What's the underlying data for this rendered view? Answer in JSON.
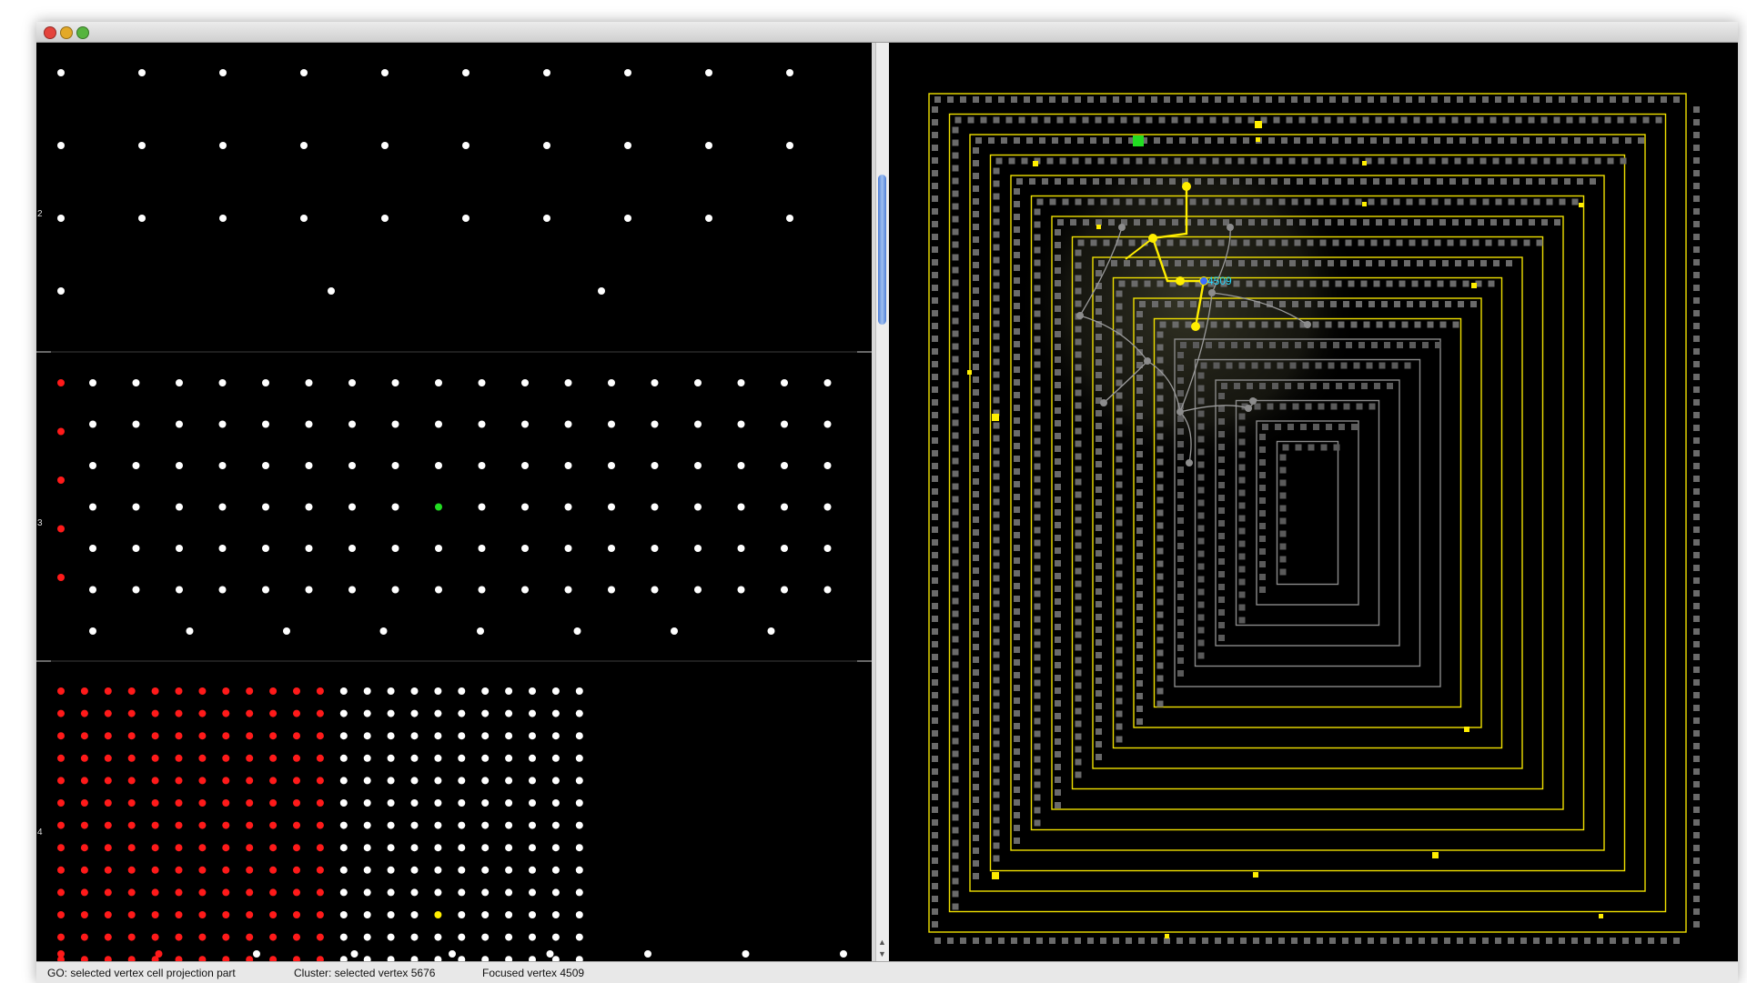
{
  "window": {
    "controls": {
      "close": "close-icon",
      "minimize": "minimize-icon",
      "zoom": "zoom-icon"
    }
  },
  "projection": {
    "row_labels": [
      "2",
      "3",
      "4"
    ],
    "colors": {
      "normal": "#ffffff",
      "cluster": "#ff1a1a",
      "selected": "#22dd22",
      "focused": "#ffee00"
    },
    "group2": {
      "rows": [
        10,
        10,
        10,
        3
      ]
    },
    "group3": {
      "rows": 7,
      "cols": 18,
      "selected_vertex": {
        "row": 3,
        "col": 8
      }
    },
    "group4": {
      "rows": 13,
      "cols": 23,
      "cluster_cols": 12,
      "focused_vertex": {
        "row": 10,
        "col": 16
      }
    }
  },
  "graph": {
    "colors": {
      "track": "#f0e000",
      "node": "#6a6a6a",
      "edge": "#9a9a9a",
      "highlight": "#ffee00",
      "label": "#22d8ff",
      "green": "#22dd22"
    },
    "focused_label": "4509"
  },
  "status": {
    "go": "GO: selected vertex cell projection part",
    "cluster": "Cluster: selected vertex 5676",
    "focused": "Focused vertex 4509"
  }
}
